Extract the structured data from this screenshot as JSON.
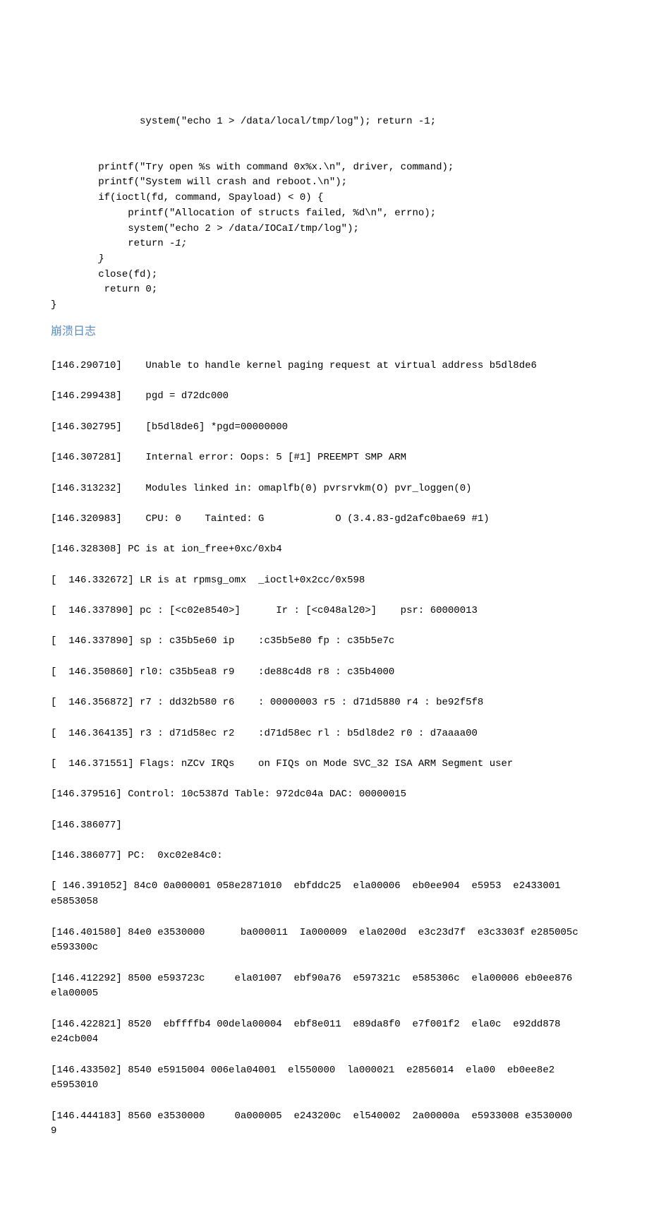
{
  "code": {
    "l1": "               system(\"echo 1 > /data/local/tmp/log\"); return -1;",
    "l2": "",
    "l3": "",
    "l4": "        printf(\"Try open %s with command 0x%x.\\n\", driver, command);",
    "l5": "        printf(\"System will crash and reboot.\\n\");",
    "l6": "        if(ioctl(fd, command, Spayload) < 0) {",
    "l7": "             printf(\"Allocation of structs failed, %d\\n\", errno);",
    "l8": "             system(\"echo 2 > /data/IOCaI/tmp/log\");",
    "l9_a": "             return ",
    "l9_b": "-1;",
    "l10": "        }",
    "l11": "        close(fd);",
    "l12": "         return 0;",
    "l13": "}"
  },
  "heading": "崩溃日志",
  "log": {
    "l1": "[146.290710]    Unable to handle kernel paging request at virtual address b5dl8de6",
    "l2": "[146.299438]    pgd = d72dc000",
    "l3": "[146.302795]    [b5dl8de6] *pgd=00000000",
    "l4": "[146.307281]    Internal error: Oops: 5 [#1] PREEMPT SMP ARM",
    "l5": "[146.313232]    Modules linked in: omaplfb(0) pvrsrvkm(O) pvr_loggen(0)",
    "l6": "[146.320983]    CPU: 0    Tainted: G            O (3.4.83-gd2afc0bae69 #1)",
    "l7": "[146.328308] PC is at ion_free+0xc/0xb4",
    "l8": "[  146.332672] LR is at rpmsg_omx  _ioctl+0x2cc/0x598",
    "l9": "[  146.337890] pc : [<c02e8540>]      Ir : [<c048al20>]    psr: 60000013",
    "l10": "[  146.337890] sp : c35b5e60 ip    :c35b5e80 fp : c35b5e7c",
    "l11": "[  146.350860] rl0: c35b5ea8 r9    :de88c4d8 r8 : c35b4000",
    "l12": "[  146.356872] r7 : dd32b580 r6    : 00000003 r5 : d71d5880 r4 : be92f5f8",
    "l13": "[  146.364135] r3 : d71d58ec r2    :d71d58ec rl : b5dl8de2 r0 : d7aaaa00",
    "l14": "[  146.371551] Flags: nZCv IRQs    on FIQs on Mode SVC_32 ISA ARM Segment user",
    "l15": "[146.379516] Control: 10c5387d Table: 972dc04a DAC: 00000015",
    "l16": "[146.386077]",
    "l17": "[146.386077] PC:  0xc02e84c0:",
    "l18": "[ 146.391052] 84c0 0a000001 058e2871010  ebfddc25  ela00006  eb0ee904  e5953  e2433001 e5853058",
    "l19": "[146.401580] 84e0 e3530000      ba000011  Ia000009  ela0200d  e3c23d7f  e3c3303f e285005c e593300c",
    "l20": "[146.412292] 8500 e593723c     ela01007  ebf90a76  e597321c  e585306c  ela00006 eb0ee876 ela00005",
    "l21": "[146.422821] 8520  ebffffb4 00dela00004  ebf8e011  e89da8f0  e7f001f2  ela0c  e92dd878 e24cb004",
    "l22": "[146.433502] 8540 e5915004 006ela04001  el550000  la000021  e2856014  ela00  eb0ee8e2 e5953010",
    "l23": "[146.444183] 8560 e3530000     0a000005  e243200c  el540002  2a00000a  e5933008 e3530000        9"
  }
}
